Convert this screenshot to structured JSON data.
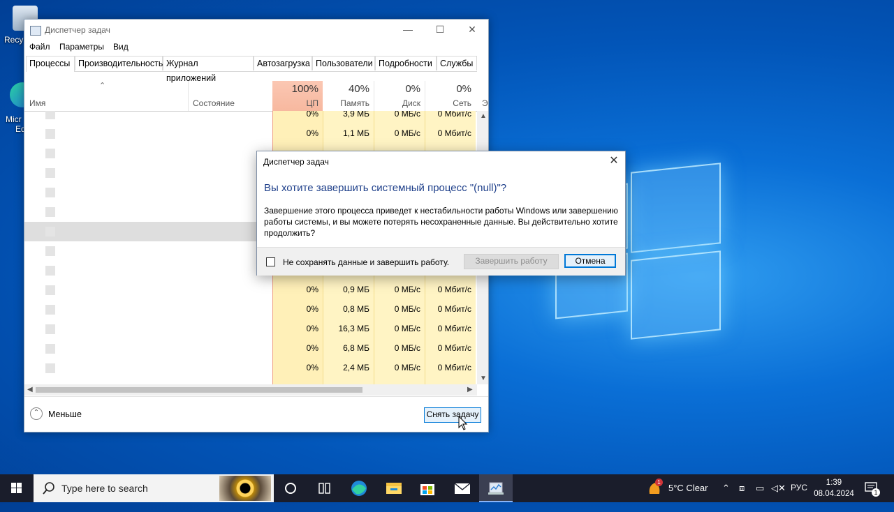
{
  "desktop": {
    "icon_recycle": "Recy",
    "icon_edge_l1": "Micr",
    "icon_edge_l2": "Ed"
  },
  "taskmanager": {
    "title": "Диспетчер задач",
    "menu": [
      "Файл",
      "Параметры",
      "Вид"
    ],
    "tabs": [
      "Процессы",
      "Производительность",
      "Журнал приложений",
      "Автозагрузка",
      "Пользователи",
      "Подробности",
      "Службы"
    ],
    "columns": {
      "name": "Имя",
      "status": "Состояние",
      "cpu_pct": "100%",
      "cpu": "ЦП",
      "mem_pct": "40%",
      "mem": "Память",
      "disk_pct": "0%",
      "disk": "Диск",
      "net_pct": "0%",
      "net": "Сеть",
      "extra": "Э"
    },
    "rows": [
      {
        "cpu": "0%",
        "mem": "3,9 МБ",
        "disk": "0 МБ/с",
        "net": "0 Мбит/с"
      },
      {
        "cpu": "0%",
        "mem": "1,1 МБ",
        "disk": "0 МБ/с",
        "net": "0 Мбит/с"
      },
      {
        "cpu": "",
        "mem": "",
        "disk": "",
        "net": ""
      },
      {
        "cpu": "",
        "mem": "",
        "disk": "",
        "net": ""
      },
      {
        "cpu": "",
        "mem": "",
        "disk": "",
        "net": ""
      },
      {
        "cpu": "",
        "mem": "",
        "disk": "",
        "net": ""
      },
      {
        "cpu": "",
        "mem": "",
        "disk": "",
        "net": ""
      },
      {
        "cpu": "",
        "mem": "",
        "disk": "",
        "net": ""
      },
      {
        "cpu": "",
        "mem": "",
        "disk": "",
        "net": ""
      },
      {
        "cpu": "0%",
        "mem": "0,9 МБ",
        "disk": "0 МБ/с",
        "net": "0 Мбит/с"
      },
      {
        "cpu": "0%",
        "mem": "0,8 МБ",
        "disk": "0 МБ/с",
        "net": "0 Мбит/с"
      },
      {
        "cpu": "0%",
        "mem": "16,3 МБ",
        "disk": "0 МБ/с",
        "net": "0 Мбит/с"
      },
      {
        "cpu": "0%",
        "mem": "6,8 МБ",
        "disk": "0 МБ/с",
        "net": "0 Мбит/с"
      },
      {
        "cpu": "0%",
        "mem": "2,4 МБ",
        "disk": "0 МБ/с",
        "net": "0 Мбит/с"
      }
    ],
    "footer": {
      "less_label": "Меньше",
      "end_task_label": "Снять задачу"
    }
  },
  "dialog": {
    "title": "Диспетчер задач",
    "heading": "Вы хотите завершить системный процесс \"(null)\"?",
    "body": "Завершение этого процесса приведет к нестабильности работы Windows или завершению работы системы, и вы можете потерять несохраненные данные. Вы действительно хотите продолжить?",
    "checkbox_label": "Не сохранять данные и завершить работу.",
    "shutdown_label": "Завершить работу",
    "cancel_label": "Отмена"
  },
  "taskbar": {
    "search_placeholder": "Type here to search",
    "weather_badge": "1",
    "weather": "5°C  Clear",
    "language": "РУС",
    "time": "1:39",
    "date": "08.04.2024",
    "notification_count": "1"
  }
}
